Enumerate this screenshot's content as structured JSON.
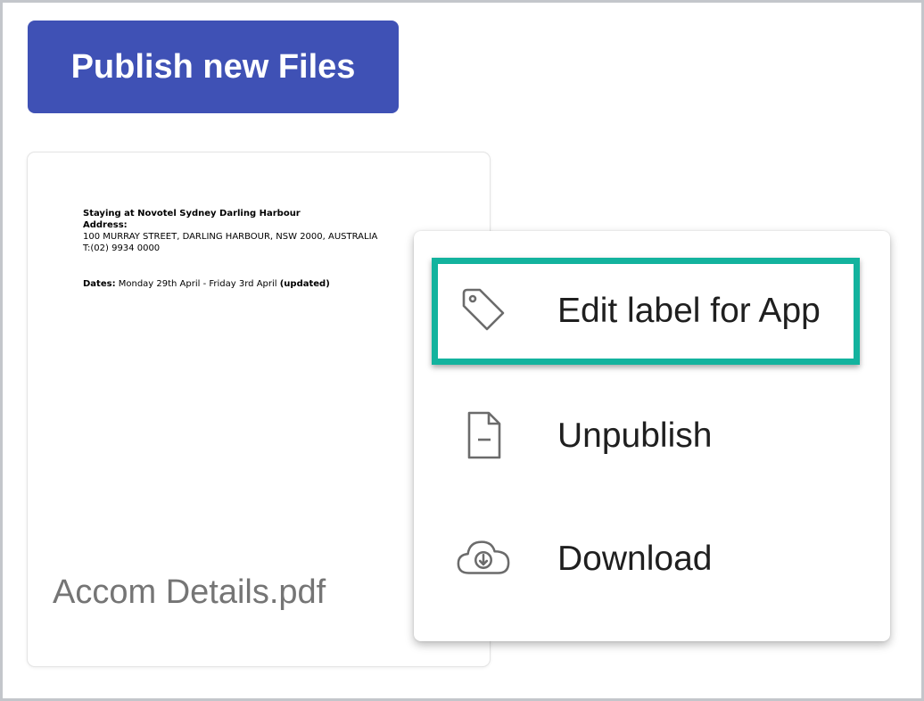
{
  "toolbar": {
    "publish_label": "Publish new Files"
  },
  "file_card": {
    "file_name": "Accom Details.pdf",
    "preview": {
      "line1": "Staying at Novotel Sydney Darling Harbour",
      "line2": "Address:",
      "line3": "100 MURRAY STREET, DARLING HARBOUR, NSW 2000, AUSTRALIA",
      "line4": "T:(02) 9934 0000",
      "dates_label": "Dates:",
      "dates_value": " Monday 29th April - Friday 3rd April ",
      "dates_note": "(updated)"
    }
  },
  "menu": {
    "items": [
      {
        "label": "Edit label for App",
        "icon": "tag-icon"
      },
      {
        "label": "Unpublish",
        "icon": "file-minus-icon"
      },
      {
        "label": "Download",
        "icon": "cloud-download-icon"
      }
    ]
  },
  "colors": {
    "primary_button": "#3f51b5",
    "highlight": "#13b39e",
    "icon_stroke": "#6b6b6b"
  }
}
